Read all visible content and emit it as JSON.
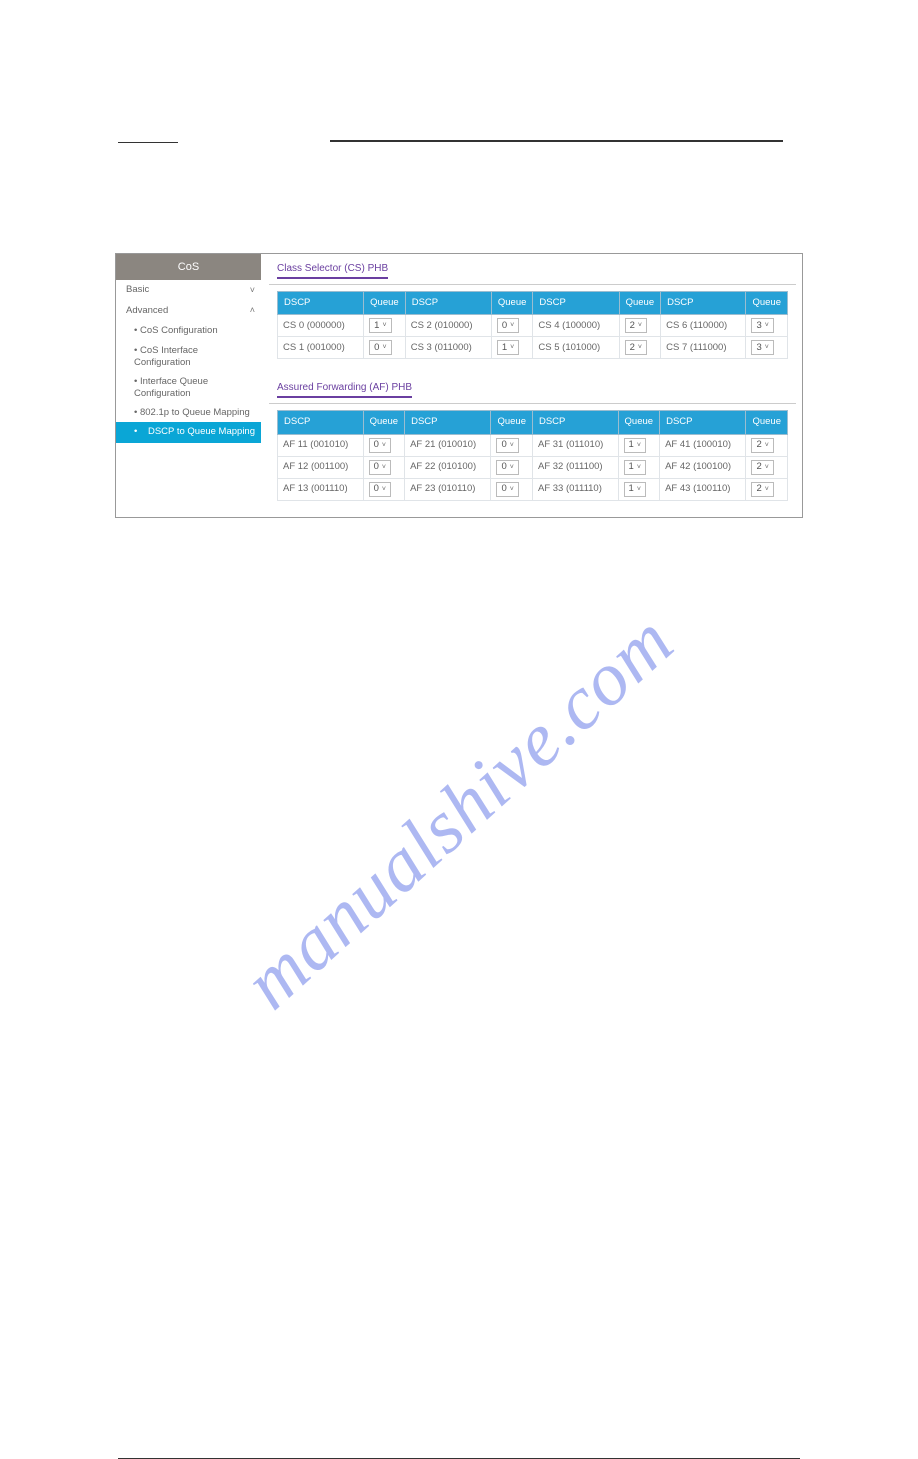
{
  "sidebar": {
    "title": "CoS",
    "items": [
      {
        "label": "Basic",
        "chev": "˅"
      },
      {
        "label": "Advanced",
        "chev": "˄"
      }
    ],
    "subs": [
      "CoS Configuration",
      "CoS Interface Configuration",
      "Interface Queue Configuration",
      "802.1p to Queue Mapping",
      "DSCP to Queue Mapping"
    ]
  },
  "cs": {
    "title": "Class Selector (CS) PHB",
    "headers": [
      "DSCP",
      "Queue",
      "DSCP",
      "Queue",
      "DSCP",
      "Queue",
      "DSCP",
      "Queue"
    ],
    "rows": [
      {
        "c1": "CS 0 (000000)",
        "q1": "1",
        "c2": "CS 2 (010000)",
        "q2": "0",
        "c3": "CS 4 (100000)",
        "q3": "2",
        "c4": "CS 6 (110000)",
        "q4": "3"
      },
      {
        "c1": "CS 1 (001000)",
        "q1": "0",
        "c2": "CS 3 (011000)",
        "q2": "1",
        "c3": "CS 5 (101000)",
        "q3": "2",
        "c4": "CS 7 (111000)",
        "q4": "3"
      }
    ]
  },
  "af": {
    "title": "Assured Forwarding (AF) PHB",
    "headers": [
      "DSCP",
      "Queue",
      "DSCP",
      "Queue",
      "DSCP",
      "Queue",
      "DSCP",
      "Queue"
    ],
    "rows": [
      {
        "c1": "AF 11 (001010)",
        "q1": "0",
        "c2": "AF 21 (010010)",
        "q2": "0",
        "c3": "AF 31 (011010)",
        "q3": "1",
        "c4": "AF 41 (100010)",
        "q4": "2"
      },
      {
        "c1": "AF 12 (001100)",
        "q1": "0",
        "c2": "AF 22 (010100)",
        "q2": "0",
        "c3": "AF 32 (011100)",
        "q3": "1",
        "c4": "AF 42 (100100)",
        "q4": "2"
      },
      {
        "c1": "AF 13 (001110)",
        "q1": "0",
        "c2": "AF 23 (010110)",
        "q2": "0",
        "c3": "AF 33 (011110)",
        "q3": "1",
        "c4": "AF 43 (100110)",
        "q4": "2"
      }
    ]
  },
  "watermark": "manualshive.com"
}
